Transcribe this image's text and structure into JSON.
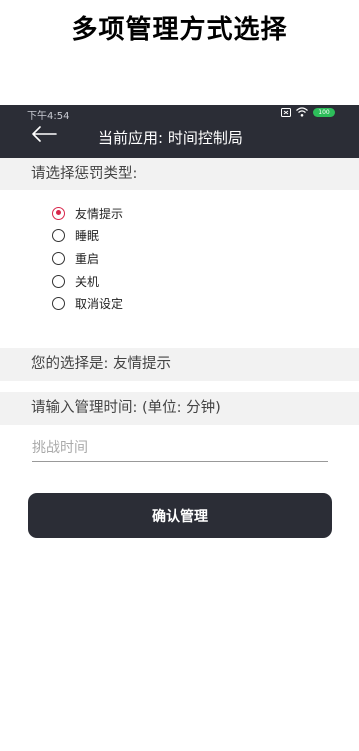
{
  "banner": {
    "title": "多项管理方式选择"
  },
  "status_bar": {
    "time": "下午4:54",
    "battery": "100"
  },
  "app_bar": {
    "title": "当前应用: 时间控制局"
  },
  "punishment": {
    "header": "请选择惩罚类型:",
    "options": [
      {
        "label": "友情提示",
        "checked": true
      },
      {
        "label": "睡眠",
        "checked": false
      },
      {
        "label": "重启",
        "checked": false
      },
      {
        "label": "关机",
        "checked": false
      },
      {
        "label": "取消设定",
        "checked": false
      }
    ]
  },
  "selection": {
    "text": "您的选择是: 友情提示"
  },
  "time_section": {
    "header": "请输入管理时间: (单位: 分钟)",
    "input_placeholder": "挑战时间",
    "input_value": ""
  },
  "confirm_button": {
    "label": "确认管理"
  },
  "colors": {
    "app_bar": "#2b2d36",
    "radio_selected": "#d8264b",
    "section_bg": "#f2f2f2"
  }
}
